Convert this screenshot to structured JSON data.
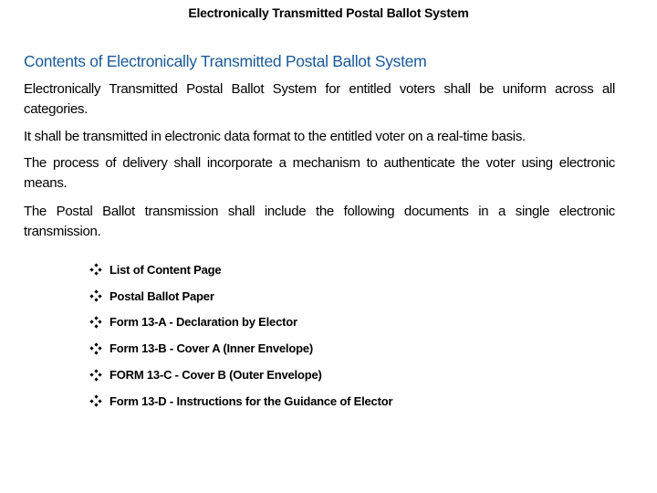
{
  "slide": {
    "title": "Electronically Transmitted Postal Ballot System",
    "heading": "Contents of Electronically Transmitted Postal Ballot System",
    "heading_color": "#1a5a96",
    "paragraphs": [
      "Electronically Transmitted Postal Ballot System for entitled voters shall be uniform across all categories.",
      "It shall be transmitted in electronic data format to the entitled voter on a real-time basis.",
      "The process of delivery shall incorporate a mechanism to authenticate the voter using electronic means.",
      "The Postal Ballot transmission shall include the following documents in a single electronic transmission."
    ],
    "bullet_icon": "four-diamond-bullet-icon",
    "documents": [
      "List of Content Page",
      "Postal Ballot Paper",
      "Form 13-A - Declaration by Elector",
      "Form 13-B - Cover A (Inner Envelope)",
      "FORM 13-C - Cover B (Outer Envelope)",
      "Form 13-D - Instructions for the Guidance of Elector"
    ]
  }
}
